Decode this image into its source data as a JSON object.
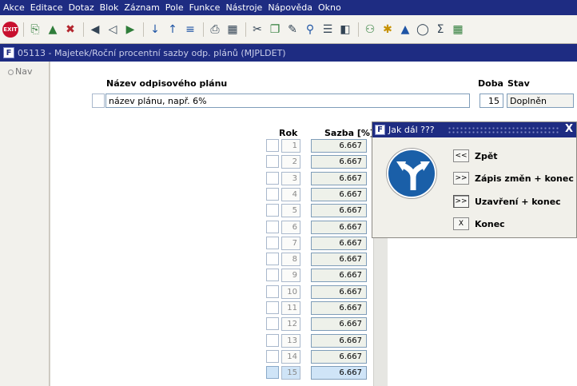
{
  "menu": [
    "Akce",
    "Editace",
    "Dotaz",
    "Blok",
    "Záznam",
    "Pole",
    "Funkce",
    "Nástroje",
    "Nápověda",
    "Okno"
  ],
  "toolbar": {
    "exit_label": "EXIT"
  },
  "window": {
    "title": "05113 - Majetek/Roční procentní sazby odp. plánů (MJPLDET)"
  },
  "nav": {
    "label": "Nav"
  },
  "form": {
    "plan_name_label": "Název odpisového plánu",
    "plan_name_value": "název plánu, např. 6%",
    "period_label": "Doba",
    "period_value": "15",
    "state_label": "Stav",
    "state_value": "Doplněn",
    "year_header": "Rok",
    "rate_header": "Sazba [%]"
  },
  "rows": [
    {
      "year": "1",
      "rate": "6.667"
    },
    {
      "year": "2",
      "rate": "6.667"
    },
    {
      "year": "3",
      "rate": "6.667"
    },
    {
      "year": "4",
      "rate": "6.667"
    },
    {
      "year": "5",
      "rate": "6.667"
    },
    {
      "year": "6",
      "rate": "6.667"
    },
    {
      "year": "7",
      "rate": "6.667"
    },
    {
      "year": "8",
      "rate": "6.667"
    },
    {
      "year": "9",
      "rate": "6.667"
    },
    {
      "year": "10",
      "rate": "6.667"
    },
    {
      "year": "11",
      "rate": "6.667"
    },
    {
      "year": "12",
      "rate": "6.667"
    },
    {
      "year": "13",
      "rate": "6.667"
    },
    {
      "year": "14",
      "rate": "6.667"
    },
    {
      "year": "15",
      "rate": "6.667"
    }
  ],
  "selected_row": 15,
  "dialog": {
    "title": "Jak dál ???",
    "close": "X",
    "options": [
      {
        "btn": "<<",
        "label": "Zpět"
      },
      {
        "btn": ">>",
        "label": "Zápis změn + konec"
      },
      {
        "btn": ">>",
        "label": "Uzavření + konec"
      },
      {
        "btn": "X",
        "label": "Konec"
      }
    ]
  }
}
